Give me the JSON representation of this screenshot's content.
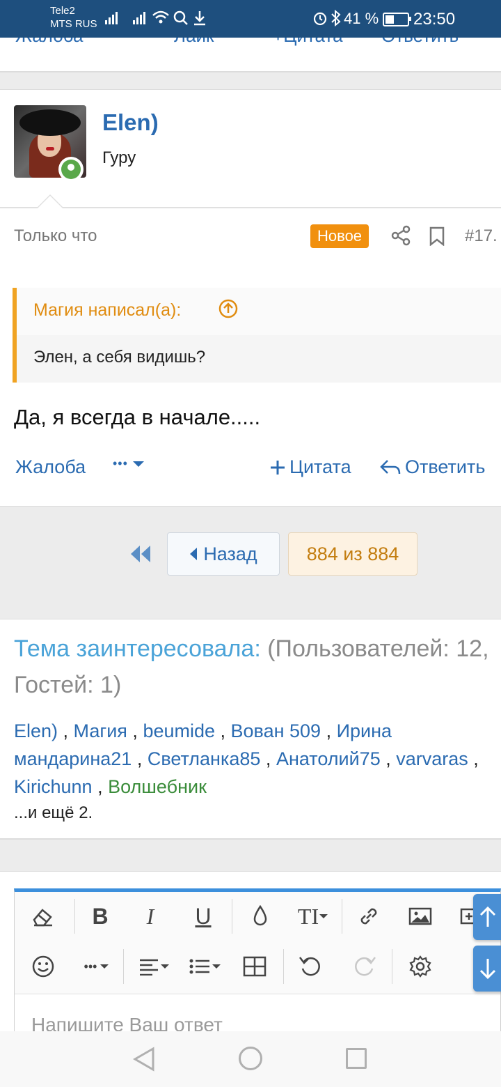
{
  "status_bar": {
    "carrier1": "Tele2",
    "carrier2": "MTS RUS",
    "battery": "41 %",
    "time": "23:50"
  },
  "prev_post_actions": {
    "report": "Жалоба",
    "like": "Лайк",
    "quote": "Цитата",
    "reply": "Ответить"
  },
  "post": {
    "username": "Elen)",
    "user_title": "Гуру",
    "time": "Только что",
    "badge": "Новое",
    "number": "#17.",
    "quote_author": "Магия написал(а):",
    "quote_text": "Элен, а себя видишь?",
    "body": "Да, я всегда в начале.....",
    "actions": {
      "report": "Жалоба",
      "more": "•••",
      "quote": "Цитата",
      "reply": "Ответить"
    }
  },
  "pager": {
    "back": "Назад",
    "position": "884 из 884"
  },
  "viewers": {
    "title_accent": "Тема заинтересовала:",
    "title_rest": "(Пользователей: 12, Гостей: 1)",
    "users": [
      "Elen)",
      "Магия",
      "beumide",
      "Вован 509",
      "Ирина мандарина21",
      "Светланка85",
      "Анатолий75",
      "varvaras",
      "Kirichunn"
    ],
    "guest_like": "Волшебник",
    "more": "...и ещё 2."
  },
  "editor": {
    "placeholder": "Напишите Ваш ответ"
  },
  "colors": {
    "status_bar": "#1e4f7e",
    "link": "#2b6bb1",
    "badge": "#f1900e",
    "quote_accent": "#f0a322",
    "editor_top": "#3c8fdc"
  }
}
